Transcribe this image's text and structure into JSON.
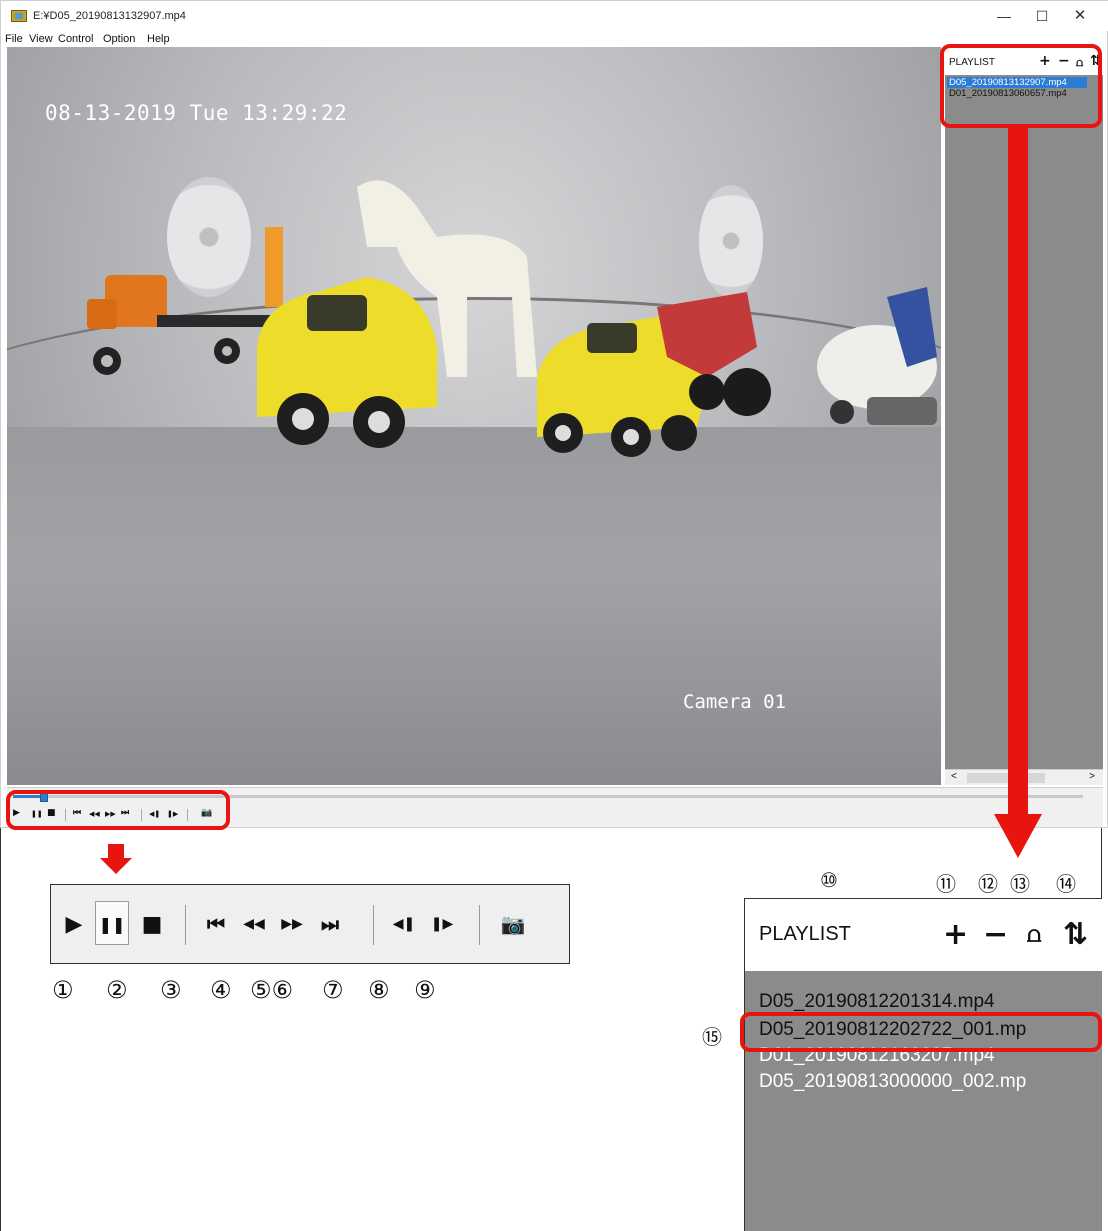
{
  "window": {
    "title": "E:¥D05_20190813132907.mp4",
    "controls": {
      "minimize": "—",
      "maximize": "☐",
      "close": "✕"
    }
  },
  "menu": {
    "items": [
      "File",
      "View",
      "Control",
      "Option",
      "Help"
    ]
  },
  "video": {
    "timestamp": "08-13-2019 Tue 13:29:22",
    "camera": "Camera 01"
  },
  "seek": {
    "progress": 0.025
  },
  "playlist_panel": {
    "title": "PLAYLIST",
    "icons": {
      "add": "+",
      "remove": "−",
      "clear": "⩍",
      "sort": "⇅"
    },
    "items": [
      {
        "label": "D05_20190813132907.mp4",
        "selected": true
      },
      {
        "label": "D01_20190813060657.mp4",
        "selected": false
      }
    ],
    "scroll": {
      "left": "<",
      "right": ">"
    }
  },
  "small_toolbar": {
    "buttons": [
      "▶",
      "❚❚",
      "■",
      "⏮",
      "◀◀",
      "▶▶",
      "⏭",
      "◀❚",
      "❚▶",
      "📷"
    ]
  },
  "zoom_toolbar": {
    "buttons": [
      "▶",
      "❚❚",
      "■",
      "⏮",
      "◀◀",
      "▶▶",
      "⏭",
      "◀❚",
      "❚▶",
      "📷"
    ],
    "numbers": [
      "①",
      "②",
      "③",
      "④",
      "⑤⑥",
      "⑦",
      "⑧",
      "⑨"
    ]
  },
  "zoom_playlist": {
    "title": "PLAYLIST",
    "icons": {
      "add": "+",
      "remove": "−",
      "clear": "⩍",
      "sort": "⇅"
    },
    "items": [
      "D05_20190812201314.mp4",
      "D05_20190812202722_001.mp",
      "D01_20190812163207.mp4",
      "D05_20190813000000_002.mp"
    ],
    "top_numbers": [
      "⑩",
      "⑪",
      "⑫",
      "⑬",
      "⑭"
    ],
    "side_number": "⑮"
  },
  "colors": {
    "annotation_red": "#e8140f",
    "selection_blue": "#2b7cd6",
    "panel_gray": "#8b8b8b"
  }
}
